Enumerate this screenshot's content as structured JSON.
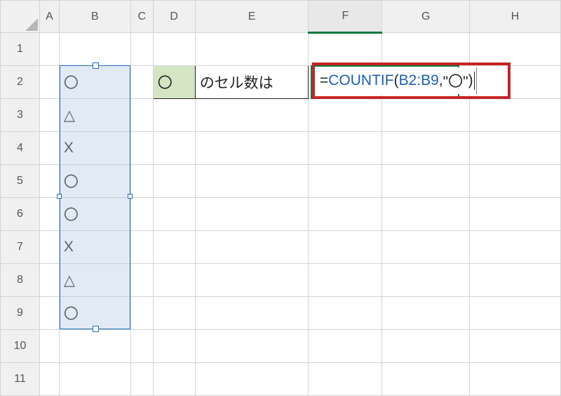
{
  "columns": [
    "A",
    "B",
    "C",
    "D",
    "E",
    "F",
    "G",
    "H"
  ],
  "rows": [
    "1",
    "2",
    "3",
    "4",
    "5",
    "6",
    "7",
    "8",
    "9",
    "10",
    "11"
  ],
  "b_values": [
    "〇",
    "△",
    "X",
    "〇",
    "〇",
    "X",
    "△",
    "〇"
  ],
  "d2_value": "〇",
  "e2_value": "のセル数は",
  "formula": {
    "prefix": "=",
    "fn": "COUNTIF",
    "open": "(",
    "range": "B2:B9",
    "sep": ",",
    "arg": "\"〇\"",
    "close": ")"
  },
  "active_cell": "F2",
  "selected_range": "B2:B9"
}
